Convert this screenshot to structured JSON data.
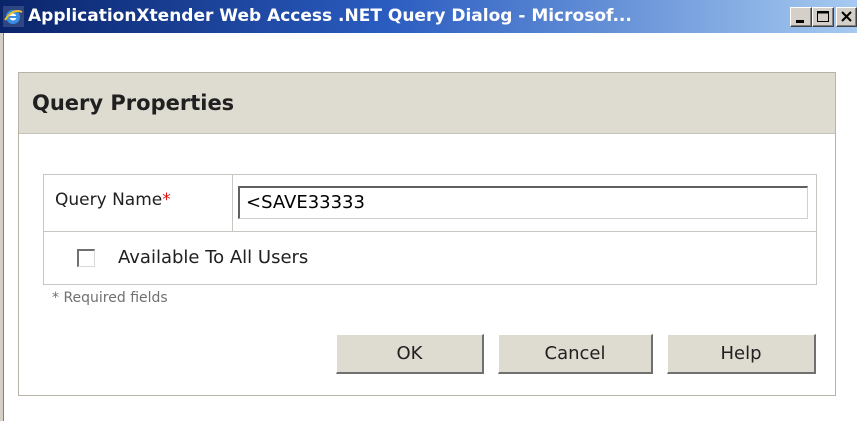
{
  "window": {
    "title": "ApplicationXtender Web Access .NET Query Dialog - Microsof...",
    "icon": "ie-browser-icon",
    "controls": [
      "minimize-icon",
      "maximize-icon",
      "close-icon"
    ]
  },
  "panel": {
    "title": "Query Properties"
  },
  "form": {
    "query_name_label": "Query Name",
    "required_marker": "*",
    "query_name_value": "<SAVE33333",
    "available_label": "Available To All Users",
    "available_checked": false,
    "required_note": "* Required fields"
  },
  "buttons": {
    "ok": "OK",
    "cancel": "Cancel",
    "help": "Help"
  },
  "colors": {
    "title_gradient_start": "#0a246a",
    "title_gradient_end": "#a6caf0",
    "panel_header": "#dedbd1",
    "required_star": "#e01010"
  }
}
